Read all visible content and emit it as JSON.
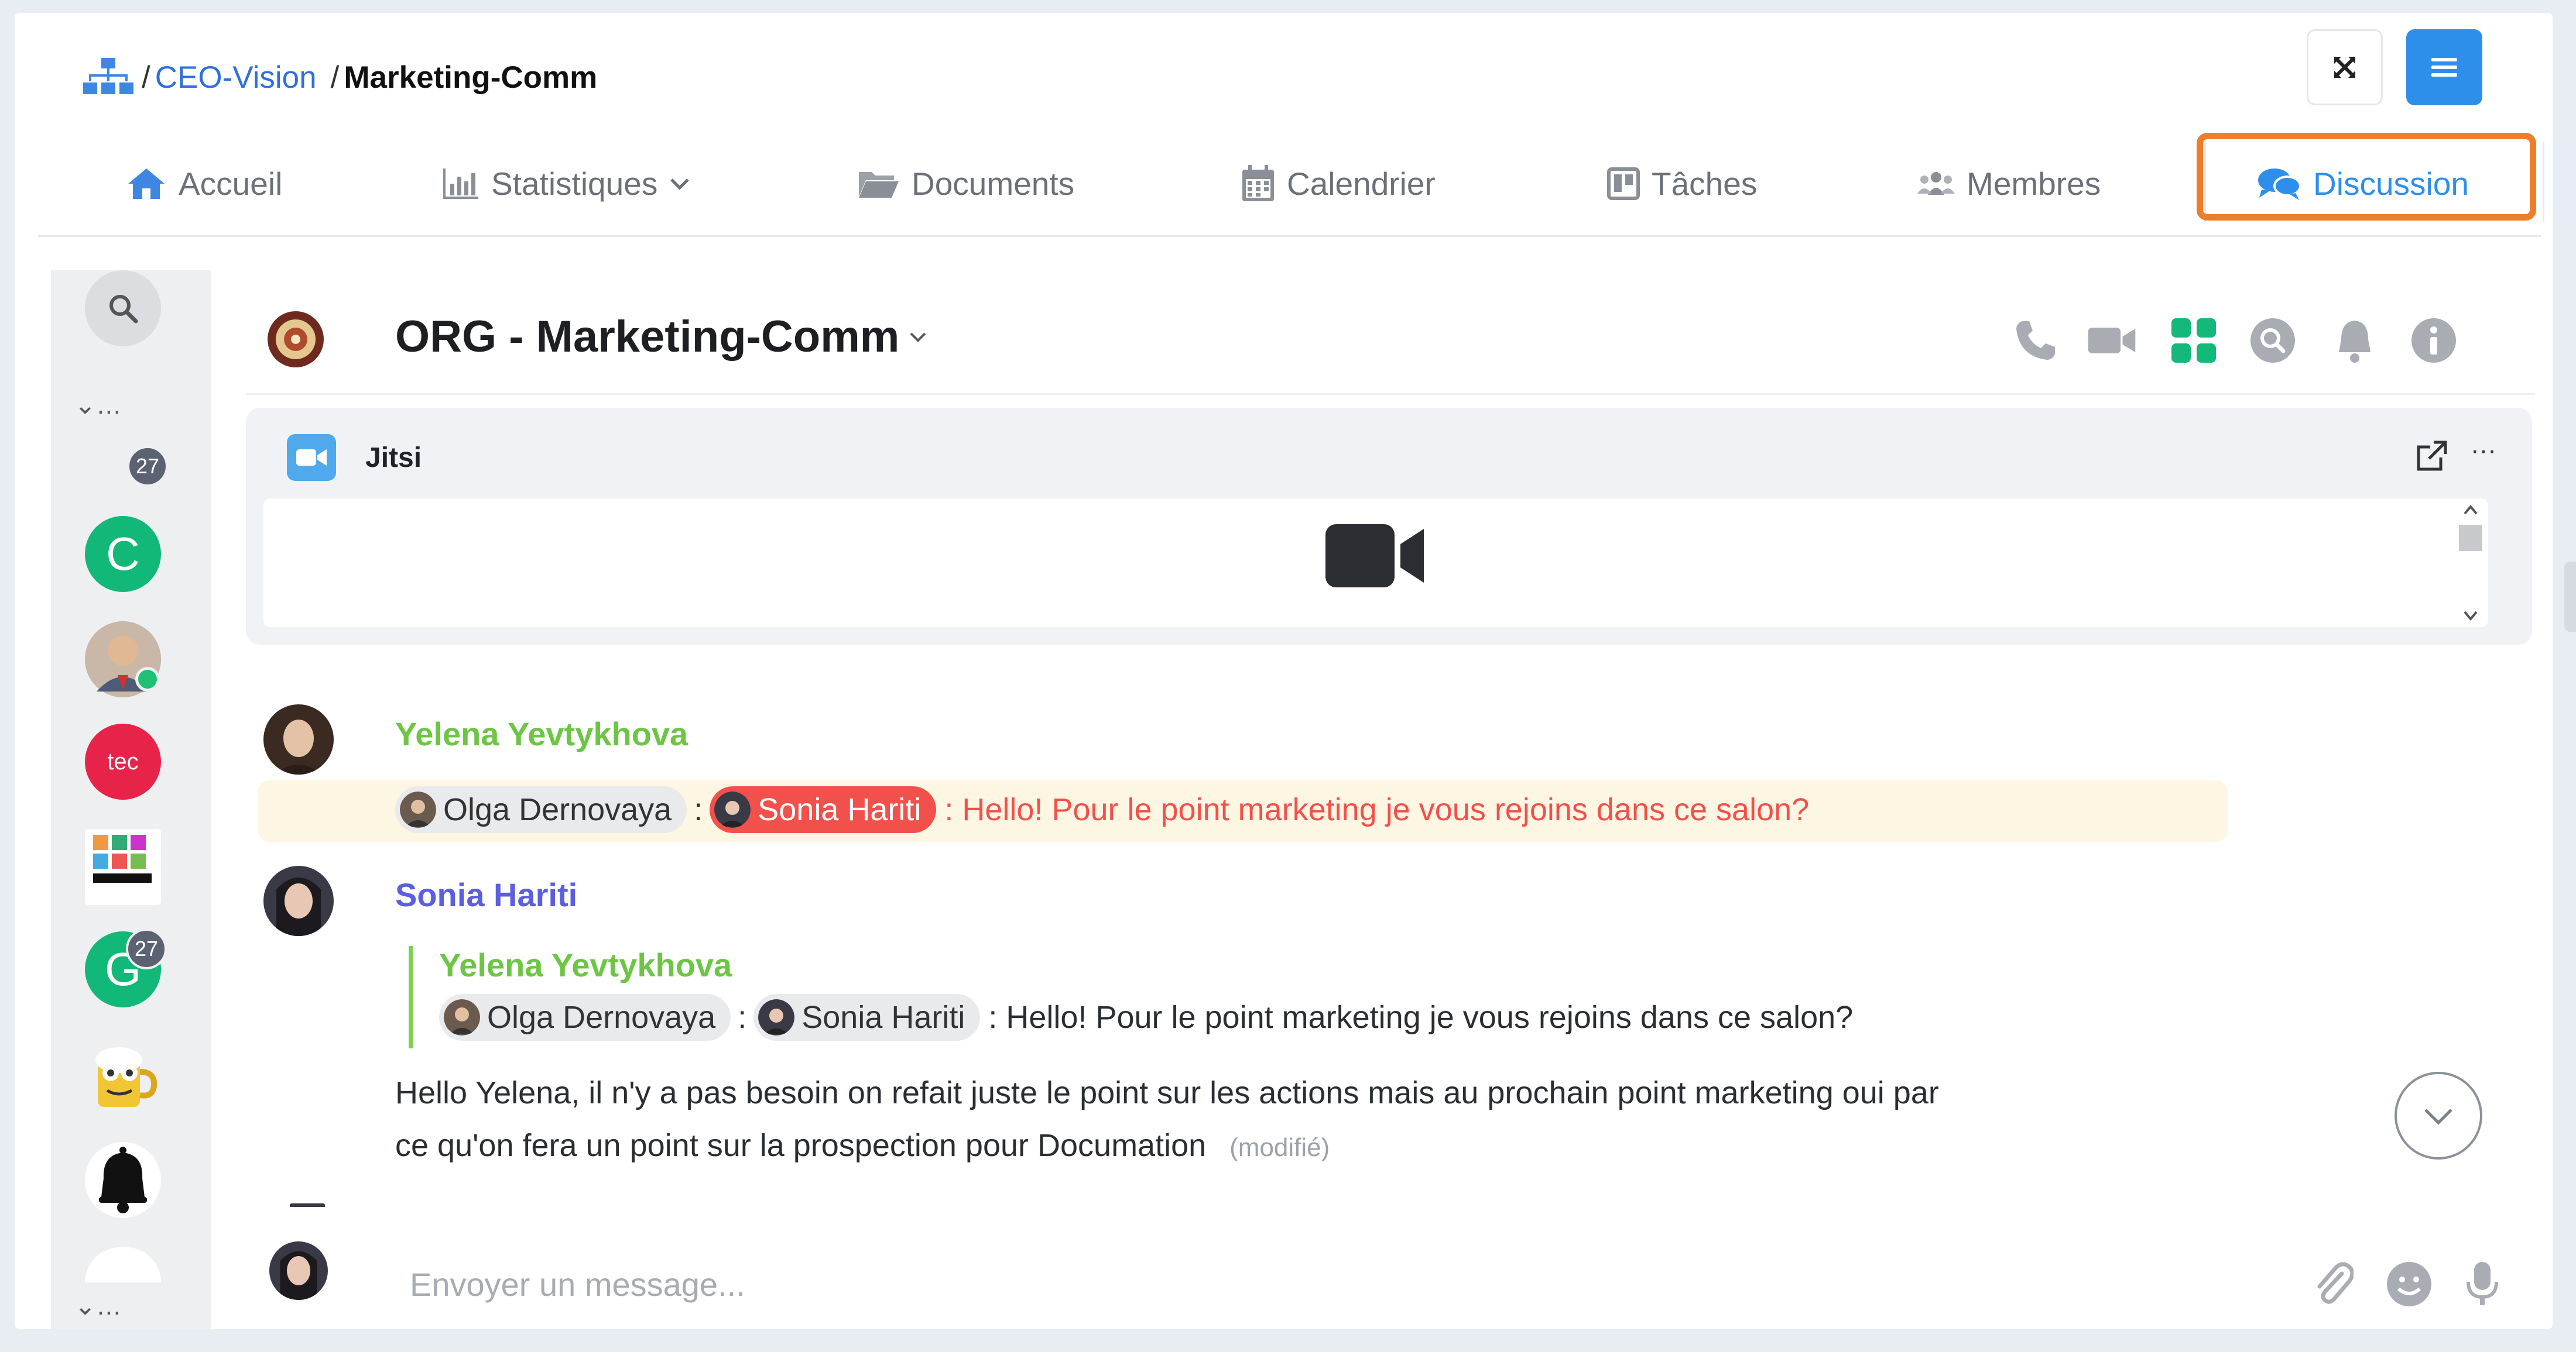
{
  "breadcrumb": {
    "root_icon": "org-chart-icon",
    "separator": "/",
    "parent": "CEO-Vision",
    "current": "Marketing-Comm"
  },
  "top_buttons": {
    "expand_icon": "expand-icon",
    "menu_icon": "hamburger-icon"
  },
  "tabs": [
    {
      "label": "Accueil",
      "icon": "home-icon"
    },
    {
      "label": "Statistiques",
      "icon": "chart-icon"
    },
    {
      "label": "Documents",
      "icon": "folder-icon"
    },
    {
      "label": "Calendrier",
      "icon": "calendar-icon"
    },
    {
      "label": "Tâches",
      "icon": "board-icon"
    },
    {
      "label": "Membres",
      "icon": "members-icon"
    },
    {
      "label": "Discussion",
      "icon": "chat-icon",
      "active": true
    }
  ],
  "rail": {
    "ellipsis_top": "⌄…",
    "ellipsis_bottom": "⌄…",
    "badge_top": "27",
    "letter_c": "C",
    "letter_g": "G",
    "badge_g": "27",
    "tec_logo_text": "tec"
  },
  "channel": {
    "title": "ORG - Marketing-Comm"
  },
  "jitsi": {
    "title": "Jitsi",
    "more": "···"
  },
  "messages": {
    "m1": {
      "author": "Yelena Yevtykhova",
      "mention1": "Olga Dernovaya",
      "colon": ":",
      "mention2": "Sonia Hariti",
      "text": ": Hello! Pour le point marketing je vous rejoins dans ce salon?"
    },
    "m2": {
      "author": "Sonia Hariti",
      "quote_author": "Yelena Yevtykhova",
      "quote_mention1": "Olga Dernovaya",
      "quote_colon": ":",
      "quote_mention2": "Sonia Hariti",
      "quote_text": ": Hello! Pour le point marketing je vous rejoins dans ce salon?",
      "line1": "Hello Yelena, il n'y a pas besoin on refait juste le point sur les actions mais au prochain point marketing oui par",
      "line2": "ce qu'on fera un point sur la prospection pour Documation",
      "edited": "(modifié)"
    }
  },
  "composer": {
    "placeholder": "Envoyer un message..."
  },
  "colors": {
    "accent": "#2e8fea",
    "highlight": "#ee7d2a",
    "author_green": "#6cc644",
    "author_purple": "#5b5ee0",
    "mention_red": "#f2504b"
  }
}
